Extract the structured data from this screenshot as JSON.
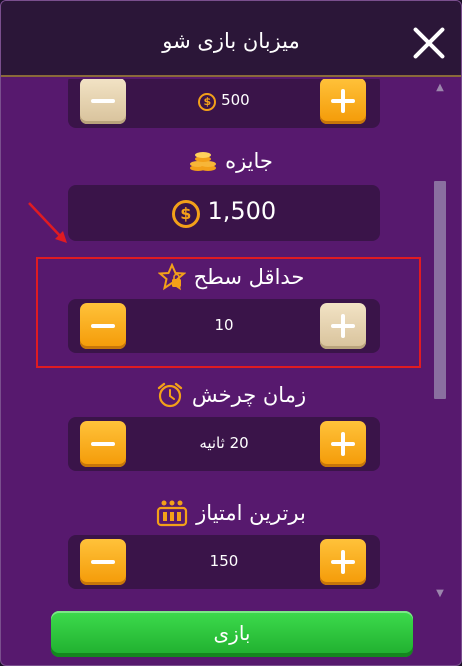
{
  "window": {
    "title": "میزبان بازی شو"
  },
  "entry_fee": {
    "value": "500"
  },
  "prize": {
    "label": "جایزه",
    "value": "1,500"
  },
  "min_level": {
    "label": "حداقل سطح",
    "value": "10"
  },
  "spin_time": {
    "label": "زمان چرخش",
    "value": "20 ثانیه"
  },
  "top_score": {
    "label": "برترین امتیاز",
    "value": "150"
  },
  "play_button": {
    "label": "بازی"
  },
  "coin_symbol": "$",
  "colors": {
    "background": "#57196e",
    "panel": "#3a1449",
    "accent_orange": "#f49a07",
    "play_green": "#1fae2e",
    "highlight_red": "#e01b22"
  },
  "icons": [
    "close-icon",
    "coin-icon",
    "coin-stack-icon",
    "star-lock-icon",
    "alarm-clock-icon",
    "score-board-icon",
    "minus-icon",
    "plus-icon",
    "arrow-icon"
  ]
}
